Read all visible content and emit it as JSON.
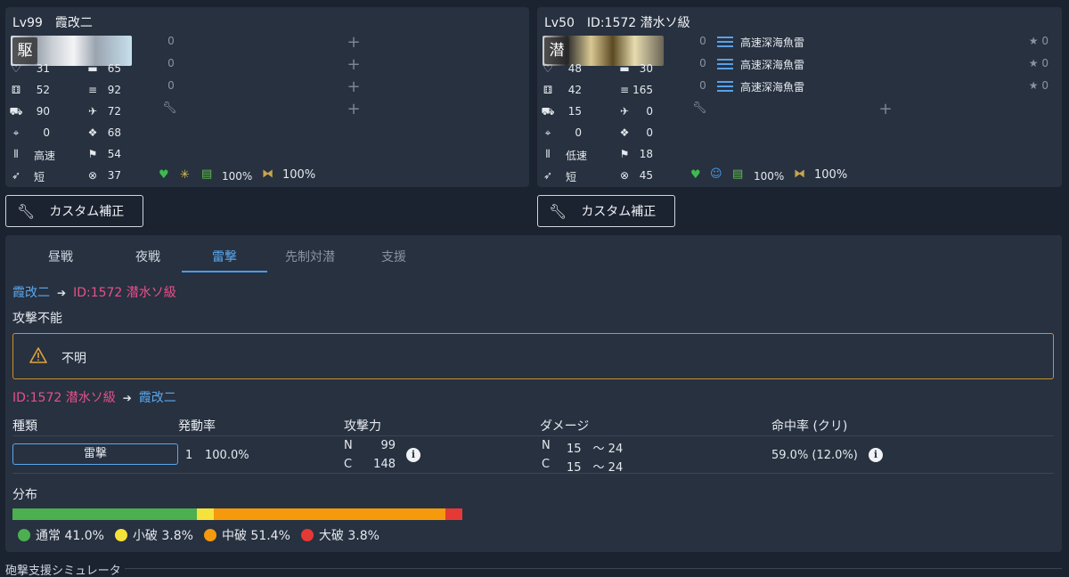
{
  "left_ship": {
    "level": "Lv99",
    "name": "霞改二",
    "badge": "駆",
    "stats": {
      "hp": "31",
      "armor_or_asw": "65",
      "firepower_grid": "52",
      "torpedo": "92",
      "aa_gun": "90",
      "aa_plane": "72",
      "evasion": "0",
      "luck": "68",
      "speed": "高速",
      "los": "54",
      "range": "短",
      "asw": "37"
    },
    "slots": [
      {
        "count": "0"
      },
      {
        "count": "0"
      },
      {
        "count": "0"
      }
    ],
    "bottom": {
      "heart_color": "#3fb950",
      "spark_color": "#d9c04a",
      "fuel": "100%",
      "ammo": "100%"
    }
  },
  "right_ship": {
    "level": "Lv50",
    "name": "ID:1572 潜水ソ級",
    "badge": "潜",
    "stats": {
      "hp": "48",
      "armor_or_asw": "30",
      "firepower_grid": "42",
      "torpedo": "165",
      "aa_gun": "15",
      "aa_plane": "0",
      "evasion": "0",
      "luck": "0",
      "speed": "低速",
      "los": "18",
      "range": "短",
      "asw": "45"
    },
    "slots": [
      {
        "count": "0",
        "name": "高速深海魚雷",
        "star": "★ 0"
      },
      {
        "count": "0",
        "name": "高速深海魚雷",
        "star": "★ 0"
      },
      {
        "count": "0",
        "name": "高速深海魚雷",
        "star": "★ 0"
      }
    ],
    "bottom": {
      "heart_color": "#3fb950",
      "face_color": "#4a9be8",
      "fuel": "100%",
      "ammo": "100%"
    }
  },
  "custom_button_label": "カスタム補正",
  "tabs": [
    "昼戦",
    "夜戦",
    "雷撃",
    "先制対潜",
    "支援"
  ],
  "active_tab": "雷撃",
  "route1": {
    "from": "霞改二",
    "to": "ID:1572 潜水ソ級"
  },
  "no_attack_label": "攻撃不能",
  "warning_text": "不明",
  "route2": {
    "from": "ID:1572 潜水ソ級",
    "to": "霞改二"
  },
  "table": {
    "headers": [
      "種類",
      "発動率",
      "攻撃力",
      "ダメージ",
      "命中率 (クリ)"
    ],
    "row": {
      "type": "雷撃",
      "rate_count": "1",
      "rate": "100.0%",
      "power_n_label": "N",
      "power_n": "99",
      "power_c_label": "C",
      "power_c": "148",
      "dmg_n_label": "N",
      "dmg_n": "15　～ 24",
      "dmg_c_label": "C",
      "dmg_c": "15　～ 24",
      "hit": "59.0%  (12.0%)"
    }
  },
  "distribution": {
    "label": "分布",
    "segments": [
      {
        "name": "通常",
        "percent": 41.0,
        "text": "通常 41.0%",
        "color": "#4caf50"
      },
      {
        "name": "小破",
        "percent": 3.8,
        "text": "小破 3.8%",
        "color": "#f5e23a"
      },
      {
        "name": "中破",
        "percent": 51.4,
        "text": "中破 51.4%",
        "color": "#f59a0c"
      },
      {
        "name": "大破",
        "percent": 3.8,
        "text": "大破 3.8%",
        "color": "#e53935"
      }
    ]
  },
  "footer": "砲撃支援シミュレータ"
}
